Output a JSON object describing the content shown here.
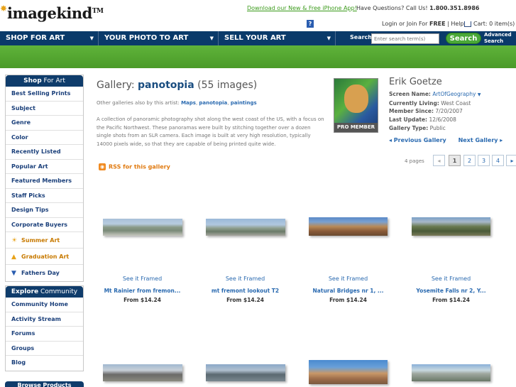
{
  "header": {
    "logo": "imagekind",
    "logo_tm": "TM",
    "iphone_link": "Download our New & Free iPhone App!",
    "questions_prefix": "Have Questions? Call Us!",
    "phone": "1.800.351.8986",
    "help_label": "?",
    "login_prefix": "Login or Join For",
    "login_free": "FREE",
    "login_suffix": "| Help",
    "cart": "Cart: 0 item(s)"
  },
  "nav": {
    "items": [
      "SHOP FOR ART",
      "YOUR PHOTO TO ART",
      "SELL YOUR ART"
    ],
    "search_label": "Search",
    "search_placeholder": "Enter search term(s)",
    "search_button": "Search",
    "advanced_line1": "Advanced",
    "advanced_line2": "Search"
  },
  "sidebar": {
    "shop_head_bold": "Shop",
    "shop_head_rest": " For Art",
    "shop_items": [
      "Best Selling Prints",
      "Subject",
      "Genre",
      "Color",
      "Recently Listed",
      "Popular Art",
      "Featured Members",
      "Staff Picks",
      "Design Tips",
      "Corporate Buyers"
    ],
    "seasonal_items": [
      "Summer Art",
      "Graduation Art",
      "Fathers Day"
    ],
    "explore_head_bold": "Explore",
    "explore_head_rest": " Community",
    "explore_items": [
      "Community Home",
      "Activity Stream",
      "Forums",
      "Groups",
      "Blog"
    ],
    "browse_head": "Browse Products"
  },
  "gallery": {
    "title_prefix": "Gallery:",
    "name": "panotopia",
    "count": "(55 images)",
    "also_by_prefix": "Other galleries also by this artist:",
    "also_by_links": [
      "Maps",
      "panotopia",
      "paintings"
    ],
    "description": "A collection of panoramic photography shot along the west coast of the US, with a focus on the Pacific Northwest. These panoramas were built by stitching together over a dozen single shots from an SLR camera. Each image is built at very high resolution, typically 14000 pixels wide, so that they are capable of being printed quite wide.",
    "rss": "RSS for this gallery"
  },
  "artist": {
    "name": "Erik Goetze",
    "badge": "PRO MEMBER",
    "screen_name_label": "Screen Name:",
    "screen_name": "ArtOfGeography",
    "living_label": "Currently Living:",
    "living": "West Coast",
    "since_label": "Member Since:",
    "since": "7/20/2007",
    "update_label": "Last Update:",
    "update": "12/6/2008",
    "type_label": "Gallery Type:",
    "type": "Public",
    "prev": "◂ Previous Gallery",
    "next": "Next Gallery ▸"
  },
  "pager": {
    "label": "4 pages",
    "pages": [
      "1",
      "2",
      "3",
      "4"
    ],
    "prev": "◂",
    "next": "▸"
  },
  "items": [
    {
      "framed": "See it Framed",
      "title": "Mt Rainier from fremon...",
      "price": "From $14.24"
    },
    {
      "framed": "See it Framed",
      "title": "mt fremont lookout T2",
      "price": "From $14.24"
    },
    {
      "framed": "See it Framed",
      "title": "Natural Bridges nr 1, ...",
      "price": "From $14.24"
    },
    {
      "framed": "See it Framed",
      "title": "Yosemite Falls nr 2, Y...",
      "price": "From $14.24"
    }
  ],
  "colors": {
    "navy": "#0f3c6b",
    "green": "#4aa838",
    "link": "#2a6ab0"
  }
}
